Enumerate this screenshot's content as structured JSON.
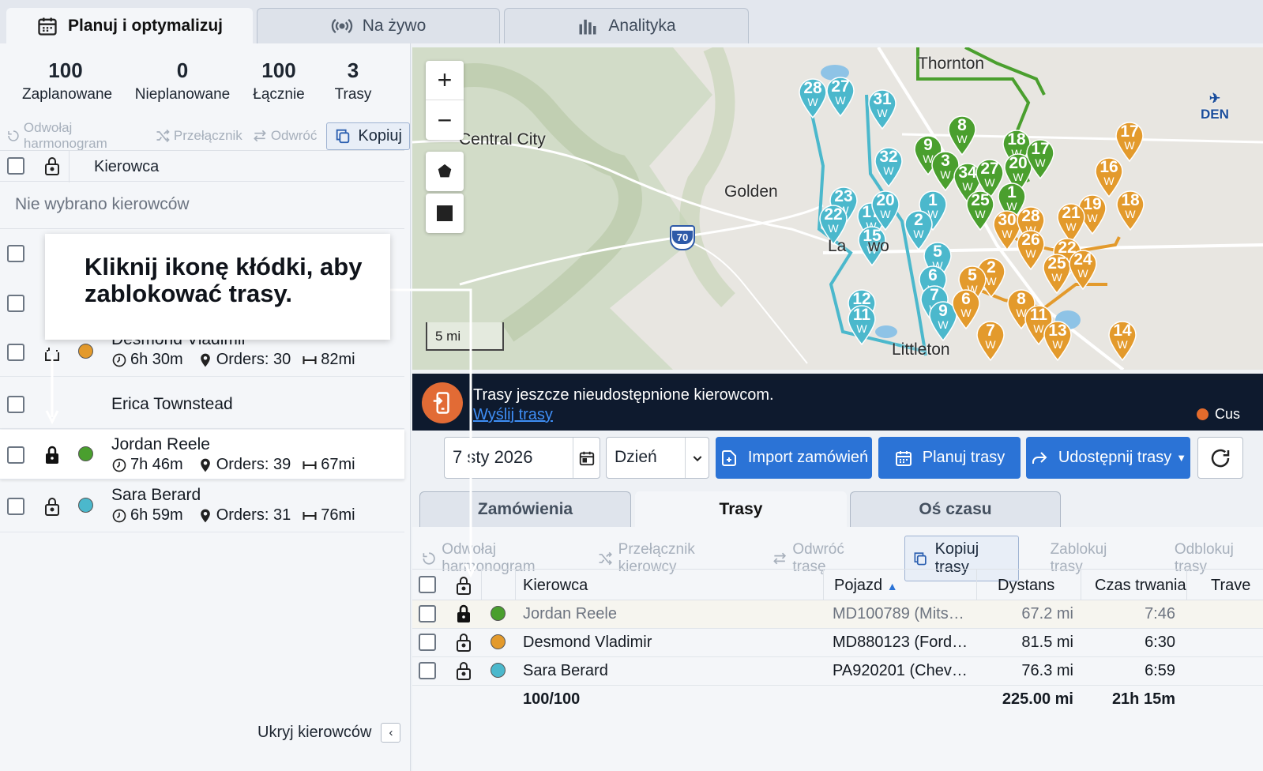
{
  "tabs": [
    {
      "label": "Planuj i optymalizuj"
    },
    {
      "label": "Na żywo"
    },
    {
      "label": "Analityka"
    }
  ],
  "stats": [
    {
      "value": "100",
      "label": "Zaplanowane"
    },
    {
      "value": "0",
      "label": "Nieplanowane"
    },
    {
      "value": "100",
      "label": "Łącznie"
    },
    {
      "value": "3",
      "label": "Trasy"
    }
  ],
  "left_toolbar": {
    "undo": "Odwołaj harmonogram",
    "swap": "Przełącznik",
    "reverse": "Odwróć",
    "copy": "Kopiuj"
  },
  "left_header": {
    "driver": "Kierowca"
  },
  "no_drivers": "Nie wybrano kierowców",
  "callout": "Kliknij ikonę kłódki, aby zablokować trasy.",
  "drivers": [
    {
      "name": "Desmond Vladimir",
      "time": "6h 30m",
      "orders": "Orders: 30",
      "dist": "82mi",
      "color": "#e39a2c"
    },
    {
      "name": "Erica Townstead"
    },
    {
      "name": "Jordan Reele",
      "time": "7h 46m",
      "orders": "Orders: 39",
      "dist": "67mi",
      "color": "#4a9f2e"
    },
    {
      "name": "Sara Berard",
      "time": "6h 59m",
      "orders": "Orders: 31",
      "dist": "76mi",
      "color": "#4bb8cc"
    }
  ],
  "hide_drivers": "Ukryj kierowców",
  "map": {
    "cities": [
      "Central City",
      "Golden",
      "Thornton",
      "Littleton",
      "DEN",
      "La",
      "wo"
    ],
    "highway": "70",
    "scale": "5 mi",
    "zoom_in": "+",
    "zoom_out": "−"
  },
  "banner": {
    "text": "Trasy jeszcze nieudostępnione kierowcom.",
    "link": "Wyślij trasy",
    "legend": "Cus"
  },
  "controls": {
    "date": "7 sty 2026",
    "period": "Dzień",
    "import": "Import zamówień",
    "plan": "Planuj trasy",
    "share": "Udostępnij trasy"
  },
  "sub_tabs": [
    {
      "label": "Zamówienia"
    },
    {
      "label": "Trasy"
    },
    {
      "label": "Oś czasu"
    }
  ],
  "routes_toolbar": {
    "undo": "Odwołaj harmonogram",
    "swap": "Przełącznik kierowcy",
    "reverse": "Odwróć trasę",
    "copy": "Kopiuj trasy",
    "lock": "Zablokuj trasy",
    "unlock": "Odblokuj trasy"
  },
  "table": {
    "headers": {
      "driver": "Kierowca",
      "vehicle": "Pojazd",
      "distance": "Dystans",
      "duration": "Czas trwania",
      "travel": "Trave"
    },
    "rows": [
      {
        "driver": "Jordan Reele",
        "vehicle": "MD100789 (Mits…",
        "distance": "67.2 mi",
        "duration": "7:46",
        "color": "#4a9f2e"
      },
      {
        "driver": "Desmond Vladimir",
        "vehicle": "MD880123 (Ford…",
        "distance": "81.5 mi",
        "duration": "6:30",
        "color": "#e39a2c"
      },
      {
        "driver": "Sara Berard",
        "vehicle": "PA920201 (Chev…",
        "distance": "76.3 mi",
        "duration": "6:59",
        "color": "#4bb8cc"
      }
    ],
    "totals": {
      "count": "100/100",
      "distance": "225.00 mi",
      "duration": "21h 15m"
    }
  },
  "map_pins": [
    {
      "label": "28",
      "sub": "W",
      "color": "#4bb8cc"
    },
    {
      "label": "27",
      "sub": "W",
      "color": "#4bb8cc"
    },
    {
      "label": "31",
      "sub": "W",
      "color": "#4bb8cc"
    },
    {
      "label": "32",
      "sub": "W",
      "color": "#4bb8cc"
    },
    {
      "label": "23",
      "sub": "W",
      "color": "#4bb8cc"
    },
    {
      "label": "22",
      "sub": "W",
      "color": "#4bb8cc"
    },
    {
      "label": "17",
      "sub": "W",
      "color": "#4bb8cc"
    },
    {
      "label": "20",
      "sub": "W",
      "color": "#4bb8cc"
    },
    {
      "label": "15",
      "sub": "W",
      "color": "#4bb8cc"
    },
    {
      "label": "1",
      "sub": "W",
      "color": "#4bb8cc"
    },
    {
      "label": "2",
      "sub": "W",
      "color": "#4bb8cc"
    },
    {
      "label": "5",
      "sub": "W",
      "color": "#4bb8cc"
    },
    {
      "label": "6",
      "sub": "W",
      "color": "#4bb8cc"
    },
    {
      "label": "7",
      "sub": "W",
      "color": "#4bb8cc"
    },
    {
      "label": "9",
      "sub": "W",
      "color": "#4bb8cc"
    },
    {
      "label": "12",
      "sub": "W",
      "color": "#4bb8cc"
    },
    {
      "label": "11",
      "sub": "W",
      "color": "#4bb8cc"
    },
    {
      "label": "8",
      "sub": "W",
      "color": "#4a9f2e"
    },
    {
      "label": "9",
      "sub": "W",
      "color": "#4a9f2e"
    },
    {
      "label": "3",
      "sub": "W",
      "color": "#4a9f2e"
    },
    {
      "label": "34",
      "sub": "W",
      "color": "#4a9f2e"
    },
    {
      "label": "27",
      "sub": "W",
      "color": "#4a9f2e"
    },
    {
      "label": "18",
      "sub": "W",
      "color": "#4a9f2e"
    },
    {
      "label": "20",
      "sub": "W",
      "color": "#4a9f2e"
    },
    {
      "label": "17",
      "sub": "W",
      "color": "#4a9f2e"
    },
    {
      "label": "25",
      "sub": "W",
      "color": "#4a9f2e"
    },
    {
      "label": "1",
      "sub": "W",
      "color": "#4a9f2e"
    },
    {
      "label": "17",
      "sub": "W",
      "color": "#e39a2c"
    },
    {
      "label": "16",
      "sub": "W",
      "color": "#e39a2c"
    },
    {
      "label": "18",
      "sub": "W",
      "color": "#e39a2c"
    },
    {
      "label": "19",
      "sub": "W",
      "color": "#e39a2c"
    },
    {
      "label": "21",
      "sub": "W",
      "color": "#e39a2c"
    },
    {
      "label": "30",
      "sub": "W",
      "color": "#e39a2c"
    },
    {
      "label": "28",
      "sub": "W",
      "color": "#e39a2c"
    },
    {
      "label": "26",
      "sub": "W",
      "color": "#e39a2c"
    },
    {
      "label": "22",
      "sub": "W",
      "color": "#e39a2c"
    },
    {
      "label": "25",
      "sub": "W",
      "color": "#e39a2c"
    },
    {
      "label": "24",
      "sub": "W",
      "color": "#e39a2c"
    },
    {
      "label": "2",
      "sub": "W",
      "color": "#e39a2c"
    },
    {
      "label": "5",
      "sub": "W",
      "color": "#e39a2c"
    },
    {
      "label": "6",
      "sub": "W",
      "color": "#e39a2c"
    },
    {
      "label": "8",
      "sub": "W",
      "color": "#e39a2c"
    },
    {
      "label": "11",
      "sub": "W",
      "color": "#e39a2c"
    },
    {
      "label": "13",
      "sub": "W",
      "color": "#e39a2c"
    },
    {
      "label": "7",
      "sub": "W",
      "color": "#e39a2c"
    },
    {
      "label": "14",
      "sub": "W",
      "color": "#e39a2c"
    }
  ]
}
